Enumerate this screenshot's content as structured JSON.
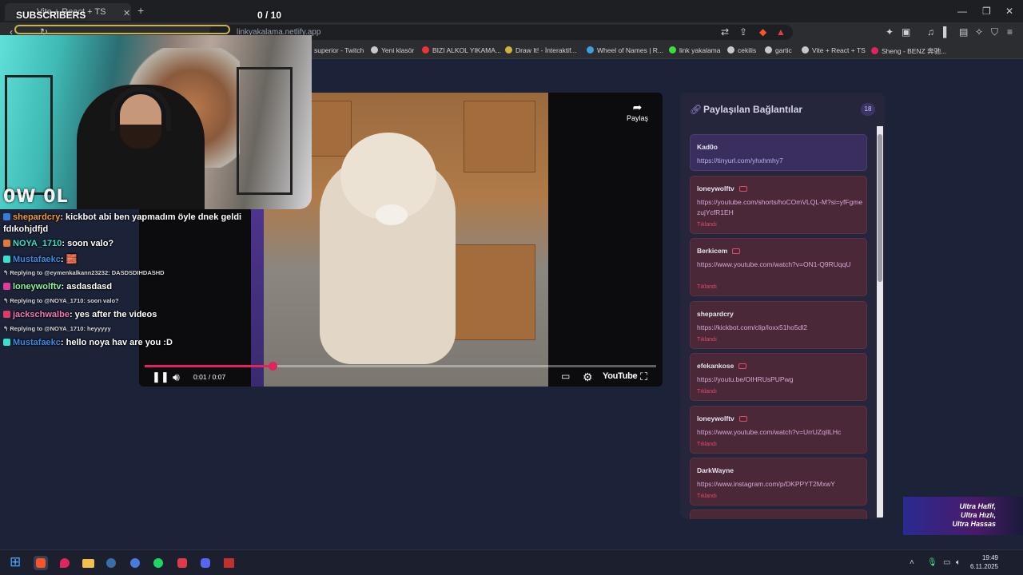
{
  "overlay": {
    "subscribers_label": "SUBSCRIBERS",
    "subscribers_count": "0 / 10",
    "cam_logo": "0W 0L"
  },
  "browser": {
    "tab_title": "Vite + React + TS",
    "address": "linkyakalama.netlify.app",
    "bookmarks": [
      {
        "label": "superior - Twitch",
        "color": "#9146ff"
      },
      {
        "label": "Yeni klasör",
        "color": "#c8c8cc"
      },
      {
        "label": "BIZI ALKOL YIKAMA...",
        "color": "#e33"
      },
      {
        "label": "Draw It! - İnteraktif...",
        "color": "#d4b13a"
      },
      {
        "label": "Wheel of Names | R...",
        "color": "#3aa0e0"
      },
      {
        "label": "link yakalama",
        "color": "#3ae03a"
      },
      {
        "label": "cekilis",
        "color": "#c8c8cc"
      },
      {
        "label": "gartic",
        "color": "#c8c8cc"
      },
      {
        "label": "Vite + React + TS",
        "color": "#c8c8cc"
      },
      {
        "label": "Sheng - BENZ 奔驰...",
        "color": "#e0245e"
      }
    ]
  },
  "chat": [
    {
      "type": "msg",
      "user": "shepardcry",
      "user_color": "#f39c3a",
      "text": "kickbot abi ben yapmadım öyle dnek geldi",
      "badge": "#3a7ae0"
    },
    {
      "type": "cont",
      "text": "fdıkohjdfjd"
    },
    {
      "type": "msg",
      "user": "NOYA_1710",
      "user_color": "#3ae0c8",
      "text": "soon valo?",
      "badge": "#e07a3a"
    },
    {
      "type": "msg",
      "user": "Mustafaekc",
      "user_color": "#3a8ae0",
      "text": "🧱",
      "badge": "#3ae0c8"
    },
    {
      "type": "reply",
      "text": "Replying to @eymenkalkann23232: DASDSDIHDASHD"
    },
    {
      "type": "msg",
      "user": "loneywolftv",
      "user_color": "#8ef0a0",
      "text": "asdasdasd",
      "badge": "#e03a9a"
    },
    {
      "type": "reply",
      "text": "Replying to @NOYA_1710: soon valo?"
    },
    {
      "type": "msg",
      "user": "jackschwalbe",
      "user_color": "#f07ab0",
      "text": "yes after the videos",
      "badge": "#e03a6a"
    },
    {
      "type": "reply",
      "text": "Replying to @NOYA_1710: heyyyyy"
    },
    {
      "type": "msg",
      "user": "Mustafaekc",
      "user_color": "#3a8ae0",
      "text": "hello noya hav are you :D",
      "badge": "#3ae0c8"
    }
  ],
  "player": {
    "share_label": "Paylaş",
    "time": "0:01 / 0:07",
    "progress": 0.25,
    "brand": "YouTube"
  },
  "panel": {
    "title": "Paylaşılan Bağlantılar",
    "count": "18",
    "cards": [
      {
        "user": "Kad0o",
        "url": "https://tinyurl.com/yhxhmhy7",
        "clicked": "",
        "youtube": false
      },
      {
        "user": "loneywolftv",
        "url": "https://youtube.com/shorts/hoCOmVLQL-M?si=yfFgmezujYcfR1EH",
        "clicked": "Tıklandı",
        "youtube": true
      },
      {
        "user": "Berkicem",
        "url": "https://www.youtube.com/watch?v=ON1-Q9RUqqU",
        "clicked": "Tıklandı",
        "youtube": true
      },
      {
        "user": "shepardcry",
        "url": "https://kickbot.com/clip/loxx51ho5dl2",
        "clicked": "Tıklandı",
        "youtube": false
      },
      {
        "user": "efekankose",
        "url": "https://youtu.be/OIHRUsPUPwg",
        "clicked": "Tıklandı",
        "youtube": true
      },
      {
        "user": "loneywolftv",
        "url": "https://www.youtube.com/watch?v=UrrUZqIlLHc",
        "clicked": "Tıklandı",
        "youtube": true
      },
      {
        "user": "DarkWayne",
        "url": "https://www.instagram.com/p/DKPPYT2MxwY",
        "clicked": "Tıklandı",
        "youtube": false
      }
    ]
  },
  "ad": {
    "lines": [
      "Ultra Hafif,",
      "Ultra Hızlı,",
      "Ultra Hassas"
    ]
  },
  "taskbar": {
    "time": "19:49",
    "date": "6.11.2025"
  }
}
